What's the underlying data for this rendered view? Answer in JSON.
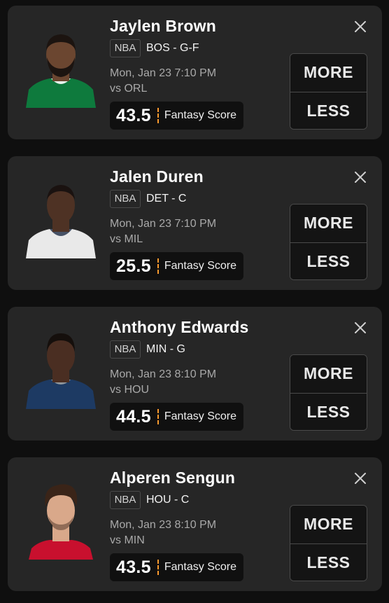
{
  "colors": {
    "background": "#0f0f0f",
    "card": "#262626",
    "accent": "#ff9b2e",
    "text": "#ffffff",
    "muted": "#a9a9a9"
  },
  "cards": [
    {
      "player": "Jaylen Brown",
      "league": "NBA",
      "team_pos": "BOS - G-F",
      "time": "Mon, Jan 23 7:10 PM",
      "opponent": "vs ORL",
      "line": "43.5",
      "stat": "Fantasy Score",
      "more_label": "MORE",
      "less_label": "LESS",
      "jersey_color": "#0e7a3d",
      "skin": "#6b4630",
      "hair": "#1c1410"
    },
    {
      "player": "Jalen Duren",
      "league": "NBA",
      "team_pos": "DET - C",
      "time": "Mon, Jan 23 7:10 PM",
      "opponent": "vs MIL",
      "line": "25.5",
      "stat": "Fantasy Score",
      "more_label": "MORE",
      "less_label": "LESS",
      "jersey_color": "#e9e9e9",
      "skin": "#4e3224",
      "hair": "#1a1210"
    },
    {
      "player": "Anthony Edwards",
      "league": "NBA",
      "team_pos": "MIN - G",
      "time": "Mon, Jan 23 8:10 PM",
      "opponent": "vs HOU",
      "line": "44.5",
      "stat": "Fantasy Score",
      "more_label": "MORE",
      "less_label": "LESS",
      "jersey_color": "#1d3a63",
      "skin": "#4a2e22",
      "hair": "#150f0c"
    },
    {
      "player": "Alperen Sengun",
      "league": "NBA",
      "team_pos": "HOU - C",
      "time": "Mon, Jan 23 8:10 PM",
      "opponent": "vs MIN",
      "line": "43.5",
      "stat": "Fantasy Score",
      "more_label": "MORE",
      "less_label": "LESS",
      "jersey_color": "#c8102e",
      "skin": "#d9a88a",
      "hair": "#3a2418"
    }
  ]
}
